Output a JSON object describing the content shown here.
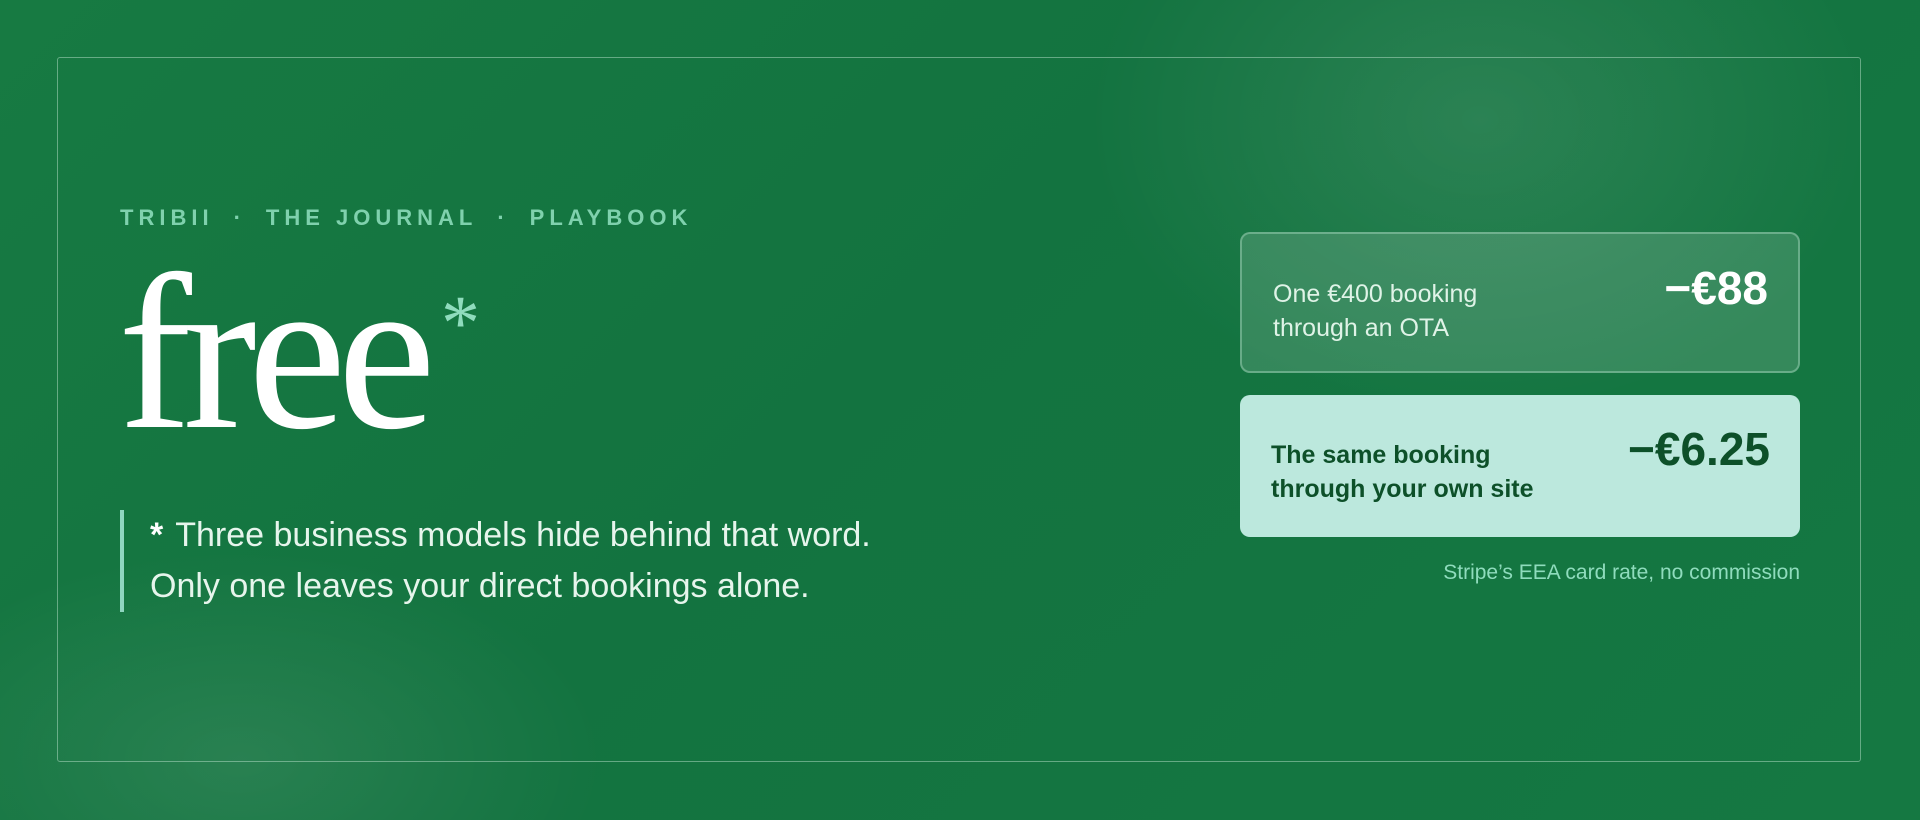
{
  "kicker": {
    "brand": "TRIBII",
    "section": "THE JOURNAL",
    "category": "PLAYBOOK",
    "separator": "·"
  },
  "headline": {
    "word": "free",
    "asterisk": "*"
  },
  "footnote": {
    "marker": "*",
    "line1": "Three business models hide behind that word.",
    "line2": "Only one leaves your direct bookings alone."
  },
  "comparison": {
    "ota": {
      "label_line1": "One €400 booking",
      "label_line2": "through an OTA",
      "amount": "−€88"
    },
    "direct": {
      "label_line1": "The same booking",
      "label_line2": "through your own site",
      "amount": "−€6.25"
    },
    "note": "Stripe’s EEA card rate, no commission"
  },
  "colors": {
    "background": "#16763f",
    "accent_mint": "#8fdcbd",
    "highlight_card": "#bce8dd",
    "dark_green_text": "#0d5029"
  }
}
